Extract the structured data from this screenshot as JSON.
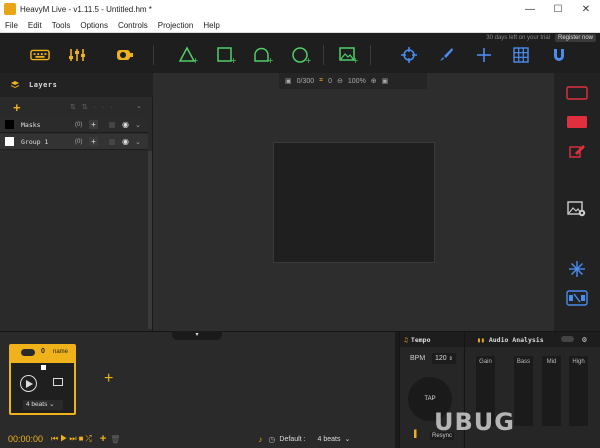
{
  "titlebar": {
    "title": "HeavyM Live - v1.11.5 - Untitled.hm *",
    "minimize": "—",
    "maximize": "☐",
    "close": "✕"
  },
  "menu": [
    "File",
    "Edit",
    "Tools",
    "Options",
    "Controls",
    "Projection",
    "Help"
  ],
  "toolbar": {
    "trial_text": "30 days left on your trial",
    "register_label": "Register now",
    "icons": [
      "keyboard-icon",
      "sliders-icon",
      "projector-icon",
      "triangle-add-icon",
      "square-add-icon",
      "arch-add-icon",
      "circle-add-icon",
      "image-add-icon",
      "target-icon",
      "brush-icon",
      "crosshair-icon",
      "grid-icon",
      "magnet-icon"
    ]
  },
  "layers": {
    "title": "Layers",
    "rows": [
      {
        "name": "Masks",
        "count": "(0)",
        "color": "#000000"
      },
      {
        "name": "Group 1",
        "count": "(0)",
        "color": "#ffffff"
      }
    ]
  },
  "canvas": {
    "shape_count": "0/300",
    "selection_count": "0",
    "zoom": "100%"
  },
  "right_tools": [
    "outline-rect-icon",
    "filled-rect-icon",
    "edit-layer-icon",
    "image-settings-icon",
    "sparkle-icon",
    "mapping-icon"
  ],
  "sequencer": {
    "card": {
      "number": "0",
      "name": "name",
      "beats": "4 beats"
    },
    "time": "00:00:00",
    "default_label": "Default :",
    "beats": "4 beats"
  },
  "tempo": {
    "title": "Tempo",
    "bpm_label": "BPM",
    "bpm_value": "120",
    "tap_label": "TAP",
    "resync_label": "Resync"
  },
  "audio": {
    "title": "Audio Analysis",
    "bands": [
      "Gain",
      "Bass",
      "Mid",
      "High"
    ]
  },
  "watermark": "UBUG",
  "colors": {
    "accent": "#f0b21a",
    "tool_green": "#4fcf6a",
    "tool_blue": "#4a8cf0",
    "tool_red": "#e03040"
  }
}
